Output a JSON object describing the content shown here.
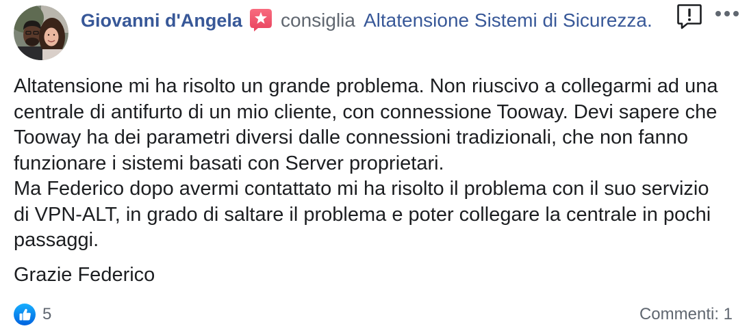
{
  "review": {
    "author": {
      "name": "Giovanni d'Angela"
    },
    "action_text": "consiglia",
    "page_name": "Altatensione Sistemi di Sicurezza.",
    "body": {
      "paragraphs": [
        {
          "lines": [
            "Altatensione mi ha risolto un grande problema. Non riuscivo a collegarmi ad una",
            "centrale di antifurto di un mio cliente, con connessione Tooway. Devi sapere che",
            "Tooway ha dei parametri diversi dalle connessioni tradizionali, che non fanno",
            "funzionare i sistemi basati con Server proprietari.",
            "Ma Federico dopo avermi contattato mi ha risolto il problema con il suo servizio",
            "di VPN-ALT, in grado di saltare il problema e poter collegare la centrale in pochi",
            "passaggi."
          ]
        },
        {
          "lines": [
            "Grazie Federico"
          ]
        }
      ]
    },
    "footer": {
      "reaction_count": "5",
      "comments_label": "Commenti: 1"
    }
  },
  "icons": {
    "avatar": "avatar-photo",
    "recommendation": "star-recommendation-icon",
    "report": "report-exclamation-icon",
    "more": "more-options-icon",
    "reaction": "like-thumbs-up-icon"
  },
  "colors": {
    "link_blue": "#385898",
    "text": "#1c1e21",
    "muted": "#606770",
    "recommend_pink": "#f35369",
    "like_blue": "#1877f2"
  }
}
